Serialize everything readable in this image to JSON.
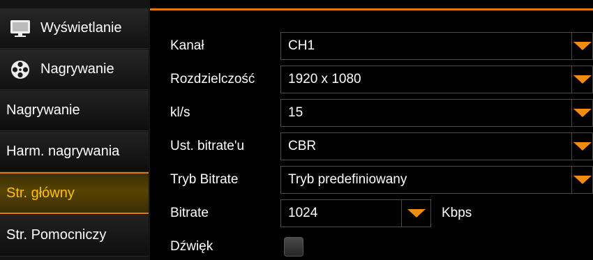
{
  "sidebar": {
    "items": [
      {
        "label": "Wyświetlanie",
        "icon": "monitor-icon"
      },
      {
        "label": "Nagrywanie",
        "icon": "film-reel-icon"
      },
      {
        "label": "Nagrywanie"
      },
      {
        "label": "Harm. nagrywania"
      },
      {
        "label": "Str. główny",
        "active": true
      },
      {
        "label": "Str. Pomocniczy"
      }
    ]
  },
  "form": {
    "channel": {
      "label": "Kanał",
      "value": "CH1"
    },
    "resolution": {
      "label": "Rozdzielczość",
      "value": "1920 x 1080"
    },
    "fps": {
      "label": "kl/s",
      "value": "15"
    },
    "bitrate_mode": {
      "label": "Ust. bitrate'u",
      "value": "CBR"
    },
    "bitrate_type": {
      "label": "Tryb Bitrate",
      "value": "Tryb predefiniowany"
    },
    "bitrate": {
      "label": "Bitrate",
      "value": "1024",
      "unit": "Kbps"
    },
    "audio": {
      "label": "Dźwięk",
      "enabled": false
    }
  },
  "colors": {
    "accent": "#e07a10",
    "active_text": "#ffc000",
    "arrow": "#f08c12"
  }
}
